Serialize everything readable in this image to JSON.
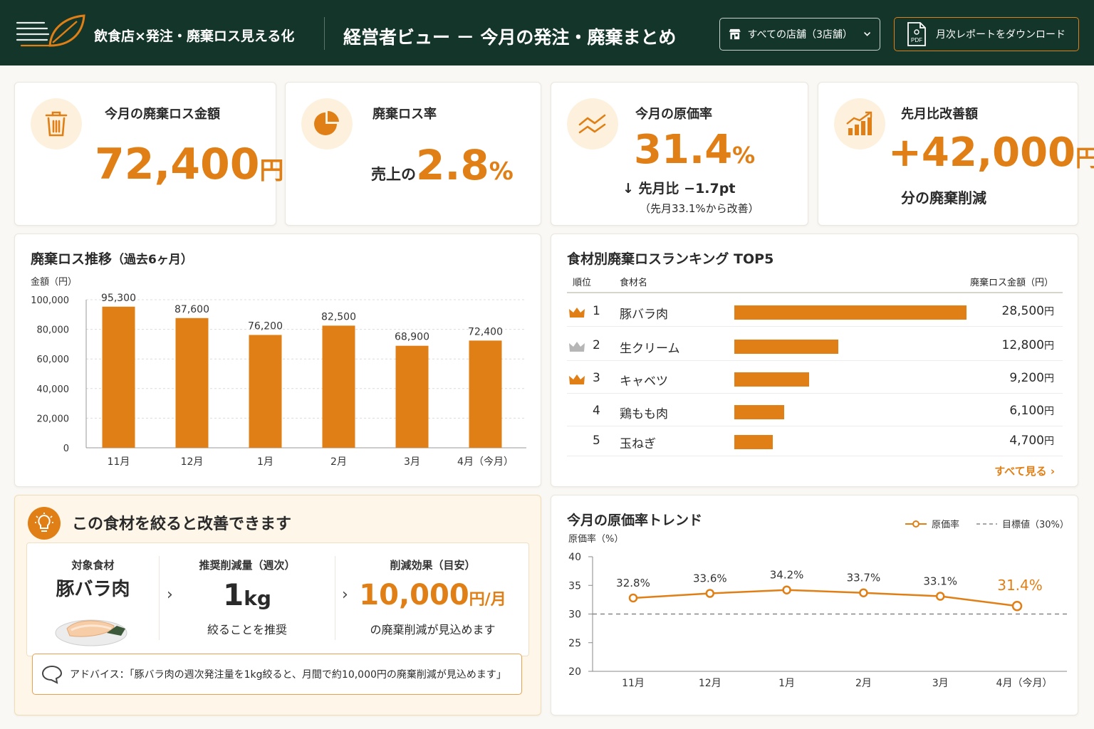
{
  "header": {
    "app_name": "飲食店×発注・廃棄ロス見える化",
    "view_title": "経営者ビュー － 今月の発注・廃棄まとめ",
    "store_select": "すべての店舗（3店舗）",
    "download_label": "月次レポートをダウンロード",
    "pdf_icon_text": "PDF",
    "accent": "#e07f15",
    "header_bg": "#14352a"
  },
  "kpis": {
    "loss_amount": {
      "label": "今月の廃棄ロス金額",
      "value": "72,400",
      "unit": "円",
      "icon": "trash-icon"
    },
    "loss_rate": {
      "label": "廃棄ロス率",
      "prefix": "売上の",
      "value": "2.8",
      "unit": "%",
      "icon": "pie-icon"
    },
    "cost_rate": {
      "label": "今月の原価率",
      "value": "31.4",
      "unit": "%",
      "change": "先月比 −1.7pt",
      "note": "（先月33.1%から改善）",
      "icon": "trend-line-icon"
    },
    "improvement": {
      "label": "先月比改善額",
      "value": "+42,000",
      "unit": "円",
      "sub": "分の廃棄削減",
      "icon": "bar-growth-icon"
    }
  },
  "loss_trend": {
    "title": "廃棄ロス推移",
    "title_sub": "（過去6ヶ月）",
    "y_axis_label": "金額（円）",
    "y_ticks": [
      "100,000",
      "80,000",
      "60,000",
      "40,000",
      "20,000",
      "0"
    ]
  },
  "chart_data": [
    {
      "type": "bar",
      "title": "廃棄ロス推移（過去6ヶ月）",
      "ylabel": "金額（円）",
      "categories": [
        "11月",
        "12月",
        "1月",
        "2月",
        "3月",
        "4月（今月）"
      ],
      "values": [
        95300,
        87600,
        76200,
        82500,
        68900,
        72400
      ],
      "labels": [
        "95,300",
        "87,600",
        "76,200",
        "82,500",
        "68,900",
        "72,400"
      ],
      "ylim": [
        0,
        100000
      ],
      "grid": true
    },
    {
      "type": "line",
      "title": "今月の原価率トレンド",
      "ylabel": "原価率（%）",
      "categories": [
        "11月",
        "12月",
        "1月",
        "2月",
        "3月",
        "4月（今月）"
      ],
      "series": [
        {
          "name": "原価率",
          "values": [
            32.8,
            33.6,
            34.2,
            33.7,
            33.1,
            31.4
          ],
          "labels": [
            "32.8%",
            "33.6%",
            "34.2%",
            "33.7%",
            "33.1%",
            "31.4%"
          ]
        },
        {
          "name": "目標値（30%）",
          "values": [
            30,
            30,
            30,
            30,
            30,
            30
          ]
        }
      ],
      "ylim": [
        20,
        40
      ],
      "y_ticks": [
        "40",
        "35",
        "30",
        "25",
        "20"
      ],
      "legend": "top-right"
    }
  ],
  "ranking": {
    "title": "食材別廃棄ロスランキング TOP5",
    "col_rank": "順位",
    "col_name": "食材名",
    "col_amount": "廃棄ロス金額（円）",
    "unit": "円",
    "view_all": "すべて見る",
    "items": [
      {
        "rank": "1",
        "name": "豚バラ肉",
        "amount": "28,500",
        "value": 28500,
        "crown": "#e07f15"
      },
      {
        "rank": "2",
        "name": "生クリーム",
        "amount": "12,800",
        "value": 12800,
        "crown": "#b6b6b6"
      },
      {
        "rank": "3",
        "name": "キャベツ",
        "amount": "9,200",
        "value": 9200,
        "crown": "#e07f15"
      },
      {
        "rank": "4",
        "name": "鶏もも肉",
        "amount": "6,100",
        "value": 6100,
        "crown": ""
      },
      {
        "rank": "5",
        "name": "玉ねぎ",
        "amount": "4,700",
        "value": 4700,
        "crown": ""
      }
    ]
  },
  "suggestion": {
    "title": "この食材を絞ると改善できます",
    "target_label": "対象食材",
    "target_name": "豚バラ肉",
    "reduce_label": "推奨削減量（週次）",
    "reduce_value": "1",
    "reduce_unit": "kg",
    "reduce_sub": "絞ることを推奨",
    "effect_label": "削減効果（目安）",
    "effect_value": "10,000",
    "effect_unit": "円/月",
    "effect_sub": "の廃棄削減が見込めます",
    "advice": "アドバイス：「豚バラ肉の週次発注量を1kg絞ると、月間で約10,000円の廃棄削減が見込めます」"
  },
  "cost_trend": {
    "title": "今月の原価率トレンド",
    "y_axis_label": "原価率（%）",
    "legend_rate": "原価率",
    "legend_target": "目標値（30%）"
  }
}
